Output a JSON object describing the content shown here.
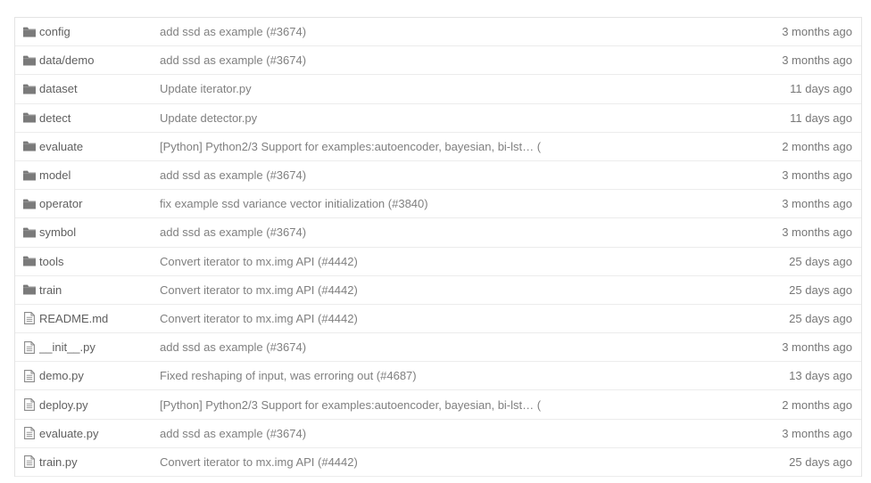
{
  "colors": {
    "folder_icon": "#7a7a7a",
    "file_icon": "#8a8a8a",
    "name_text": "#5f5f5f",
    "message_text": "#808080",
    "age_text": "#777777",
    "row_border": "#ececec"
  },
  "rows": [
    {
      "type": "folder",
      "icon": "folder-icon",
      "name": "config",
      "message": "add ssd as example (#3674)",
      "age": "3 months ago"
    },
    {
      "type": "folder",
      "icon": "folder-icon",
      "name": "data/demo",
      "message": "add ssd as example (#3674)",
      "age": "3 months ago"
    },
    {
      "type": "folder",
      "icon": "folder-icon",
      "name": "dataset",
      "message": "Update iterator.py",
      "age": "11 days ago"
    },
    {
      "type": "folder",
      "icon": "folder-icon",
      "name": "detect",
      "message": "Update detector.py",
      "age": "11 days ago"
    },
    {
      "type": "folder",
      "icon": "folder-icon",
      "name": "evaluate",
      "message": "[Python] Python2/3 Support for examples:autoencoder, bayesian, bi-lst… (",
      "age": "2 months ago"
    },
    {
      "type": "folder",
      "icon": "folder-icon",
      "name": "model",
      "message": "add ssd as example (#3674)",
      "age": "3 months ago"
    },
    {
      "type": "folder",
      "icon": "folder-icon",
      "name": "operator",
      "message": "fix example ssd variance vector initialization (#3840)",
      "age": "3 months ago"
    },
    {
      "type": "folder",
      "icon": "folder-icon",
      "name": "symbol",
      "message": "add ssd as example (#3674)",
      "age": "3 months ago"
    },
    {
      "type": "folder",
      "icon": "folder-icon",
      "name": "tools",
      "message": "Convert iterator to mx.img API (#4442)",
      "age": "25 days ago"
    },
    {
      "type": "folder",
      "icon": "folder-icon",
      "name": "train",
      "message": "Convert iterator to mx.img API (#4442)",
      "age": "25 days ago"
    },
    {
      "type": "file",
      "icon": "file-icon",
      "name": "README.md",
      "message": "Convert iterator to mx.img API (#4442)",
      "age": "25 days ago"
    },
    {
      "type": "file",
      "icon": "file-icon",
      "name": "__init__.py",
      "message": "add ssd as example (#3674)",
      "age": "3 months ago"
    },
    {
      "type": "file",
      "icon": "file-icon",
      "name": "demo.py",
      "message": "Fixed reshaping of input, was erroring out (#4687)",
      "age": "13 days ago"
    },
    {
      "type": "file",
      "icon": "file-icon",
      "name": "deploy.py",
      "message": "[Python] Python2/3 Support for examples:autoencoder, bayesian, bi-lst… (",
      "age": "2 months ago"
    },
    {
      "type": "file",
      "icon": "file-icon",
      "name": "evaluate.py",
      "message": "add ssd as example (#3674)",
      "age": "3 months ago"
    },
    {
      "type": "file",
      "icon": "file-icon",
      "name": "train.py",
      "message": "Convert iterator to mx.img API (#4442)",
      "age": "25 days ago"
    }
  ]
}
